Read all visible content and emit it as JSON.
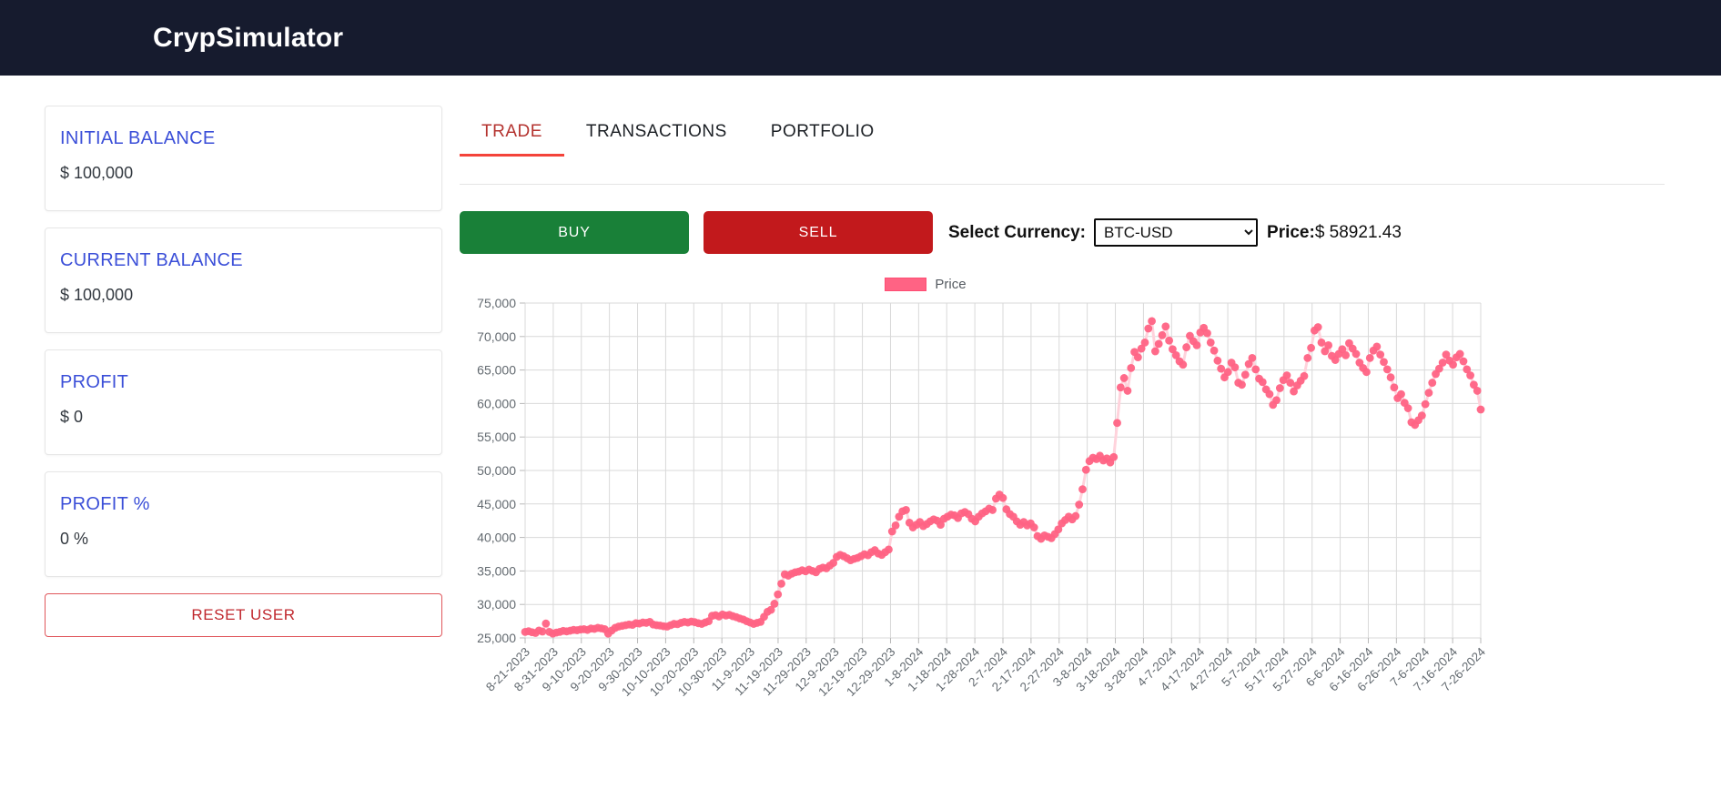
{
  "header": {
    "title": "CrypSimulator"
  },
  "sidebar": {
    "cards": [
      {
        "title": "INITIAL BALANCE",
        "value": "$ 100,000"
      },
      {
        "title": "CURRENT BALANCE",
        "value": "$ 100,000"
      },
      {
        "title": "PROFIT",
        "value": "$ 0"
      },
      {
        "title": "PROFIT %",
        "value": "0 %"
      }
    ],
    "reset_label": "RESET USER"
  },
  "main": {
    "tabs": [
      {
        "label": "TRADE",
        "active": true
      },
      {
        "label": "TRANSACTIONS",
        "active": false
      },
      {
        "label": "PORTFOLIO",
        "active": false
      }
    ],
    "buy_label": "BUY",
    "sell_label": "SELL",
    "currency_label": "Select Currency:",
    "currency_value": "BTC-USD",
    "currency_options": [
      "BTC-USD"
    ],
    "price_label": "Price:",
    "price_value": "$ 58921.43"
  },
  "colors": {
    "accent_red": "#f4433a",
    "buy_green": "#198038",
    "sell_red": "#c2191c",
    "card_title_blue": "#3b4fd8",
    "series_pink": "#ff6384",
    "header_navy": "#161b2e"
  },
  "chart_data": {
    "type": "scatter",
    "title": "",
    "xlabel": "",
    "ylabel": "",
    "grid": true,
    "legend": [
      {
        "name": "Price",
        "color": "#ff6384"
      }
    ],
    "legend_position": "top",
    "ylim": [
      25000,
      75000
    ],
    "yticks": [
      25000,
      30000,
      35000,
      40000,
      45000,
      50000,
      55000,
      60000,
      65000,
      70000,
      75000
    ],
    "ytick_labels": [
      "25,000",
      "30,000",
      "35,000",
      "40,000",
      "45,000",
      "50,000",
      "55,000",
      "60,000",
      "65,000",
      "70,000",
      "75,000"
    ],
    "xtick_labels": [
      "8-21-2023",
      "8-31-2023",
      "9-10-2023",
      "9-20-2023",
      "9-30-2023",
      "10-10-2023",
      "10-20-2023",
      "10-30-2023",
      "11-9-2023",
      "11-19-2023",
      "11-29-2023",
      "12-9-2023",
      "12-19-2023",
      "12-29-2023",
      "1-8-2024",
      "1-18-2024",
      "1-28-2024",
      "2-7-2024",
      "2-17-2024",
      "2-27-2024",
      "3-8-2024",
      "3-18-2024",
      "3-28-2024",
      "4-7-2024",
      "4-17-2024",
      "4-27-2024",
      "5-7-2024",
      "5-17-2024",
      "5-27-2024",
      "6-6-2024",
      "6-16-2024",
      "6-26-2024",
      "7-6-2024",
      "7-16-2024",
      "7-26-2024"
    ],
    "x_start_date": "8-21-2023",
    "x_end_date": "7-26-2024",
    "x_tick_interval_days": 10,
    "series": [
      {
        "name": "Price",
        "color": "#ff6384",
        "values": [
          25900,
          26000,
          25850,
          25750,
          26100,
          25950,
          27150,
          25900,
          25650,
          25800,
          25900,
          26050,
          25980,
          26080,
          26200,
          26150,
          26250,
          26300,
          26200,
          26400,
          26350,
          26500,
          26430,
          26300,
          25650,
          26100,
          26500,
          26700,
          26800,
          26900,
          27000,
          26950,
          27200,
          27150,
          27300,
          27250,
          27400,
          27000,
          26900,
          26850,
          26750,
          26700,
          26900,
          27100,
          27050,
          27250,
          27400,
          27300,
          27450,
          27350,
          27200,
          27100,
          27300,
          27500,
          28300,
          28400,
          28200,
          28500,
          28350,
          28450,
          28250,
          28100,
          27900,
          27750,
          27500,
          27300,
          27100,
          27250,
          27400,
          28150,
          28900,
          29200,
          30100,
          31500,
          33100,
          34500,
          34300,
          34600,
          34800,
          34900,
          35100,
          34950,
          35200,
          35000,
          34800,
          35300,
          35500,
          35400,
          35800,
          36200,
          37100,
          37400,
          37200,
          36900,
          36600,
          36800,
          36950,
          37200,
          37500,
          37350,
          37800,
          38100,
          37600,
          37400,
          37800,
          38200,
          40900,
          41800,
          43100,
          43900,
          44100,
          42200,
          41500,
          41900,
          42300,
          41700,
          42000,
          42400,
          42700,
          42500,
          41900,
          42800,
          43100,
          43400,
          43300,
          42900,
          43600,
          43800,
          43500,
          42800,
          42400,
          43100,
          43600,
          43900,
          44300,
          44100,
          45800,
          46400,
          45900,
          44200,
          43500,
          43100,
          42400,
          41900,
          42300,
          41800,
          42100,
          41500,
          40200,
          39800,
          40300,
          40100,
          39900,
          40500,
          41200,
          42100,
          42600,
          43100,
          42700,
          43200,
          44900,
          47200,
          50100,
          51400,
          51900,
          51700,
          52200,
          51500,
          51800,
          51200,
          52000,
          57100,
          62400,
          63800,
          61900,
          65300,
          67700,
          66900,
          68200,
          69100,
          71200,
          72300,
          67800,
          68900,
          70200,
          71500,
          69400,
          68100,
          67200,
          66300,
          65800,
          68400,
          70100,
          69300,
          68700,
          70600,
          71300,
          70500,
          69100,
          67900,
          66400,
          65200,
          63900,
          64700,
          66100,
          65400,
          63100,
          62800,
          64300,
          65900,
          66800,
          65100,
          63700,
          63200,
          62100,
          61400,
          59800,
          60500,
          62300,
          63500,
          64200,
          63100,
          61800,
          62700,
          63400,
          64100,
          66800,
          68300,
          70900,
          71400,
          69100,
          67800,
          68700,
          67100,
          66500,
          67400,
          68100,
          67200,
          69000,
          68200,
          67400,
          66100,
          65300,
          64700,
          66800,
          67900,
          68500,
          67300,
          66200,
          65100,
          63900,
          62400,
          60800,
          61400,
          60100,
          59300,
          57200,
          56800,
          57500,
          58200,
          59900,
          61600,
          63100,
          64400,
          65200,
          66100,
          67300,
          66400,
          65800,
          66900,
          67400,
          66300,
          65100,
          64200,
          62800,
          61900,
          59100
        ]
      }
    ]
  }
}
